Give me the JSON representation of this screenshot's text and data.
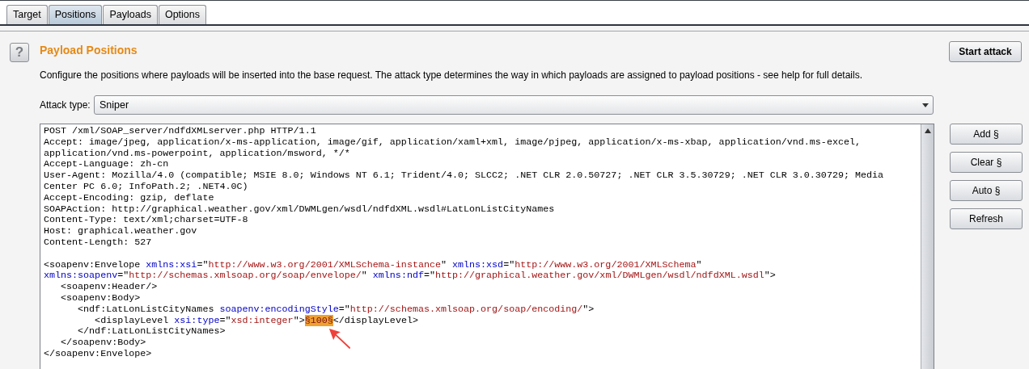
{
  "tabs": [
    {
      "label": "Target",
      "selected": false
    },
    {
      "label": "Positions",
      "selected": true
    },
    {
      "label": "Payloads",
      "selected": false
    },
    {
      "label": "Options",
      "selected": false
    }
  ],
  "help_icon": "?",
  "title": "Payload Positions",
  "description": "Configure the positions where payloads will be inserted into the base request. The attack type determines the way in which payloads are assigned to payload positions - see help for full details.",
  "start_button": "Start attack",
  "attack_type": {
    "label": "Attack type:",
    "value": "Sniper"
  },
  "editor_lines": [
    {
      "segments": [
        {
          "kind": "text",
          "text": "POST /xml/SOAP_server/ndfdXMLserver.php HTTP/1.1"
        }
      ]
    },
    {
      "segments": [
        {
          "kind": "text",
          "text": "Accept: image/jpeg, application/x-ms-application, image/gif, application/xaml+xml, image/pjpeg, application/x-ms-xbap, application/vnd.ms-excel,"
        }
      ]
    },
    {
      "segments": [
        {
          "kind": "text",
          "text": "application/vnd.ms-powerpoint, application/msword, */*"
        }
      ]
    },
    {
      "segments": [
        {
          "kind": "text",
          "text": "Accept-Language: zh-cn"
        }
      ]
    },
    {
      "segments": [
        {
          "kind": "text",
          "text": "User-Agent: Mozilla/4.0 (compatible; MSIE 8.0; Windows NT 6.1; Trident/4.0; SLCC2; .NET CLR 2.0.50727; .NET CLR 3.5.30729; .NET CLR 3.0.30729; Media"
        }
      ]
    },
    {
      "segments": [
        {
          "kind": "text",
          "text": "Center PC 6.0; InfoPath.2; .NET4.0C)"
        }
      ]
    },
    {
      "segments": [
        {
          "kind": "text",
          "text": "Accept-Encoding: gzip, deflate"
        }
      ]
    },
    {
      "segments": [
        {
          "kind": "text",
          "text": "SOAPAction: http://graphical.weather.gov/xml/DWMLgen/wsdl/ndfdXML.wsdl#LatLonListCityNames"
        }
      ]
    },
    {
      "segments": [
        {
          "kind": "text",
          "text": "Content-Type: text/xml;charset=UTF-8"
        }
      ]
    },
    {
      "segments": [
        {
          "kind": "text",
          "text": "Host: graphical.weather.gov"
        }
      ]
    },
    {
      "segments": [
        {
          "kind": "text",
          "text": "Content-Length: 527"
        }
      ]
    },
    {
      "kind": "blank"
    },
    {
      "segments": [
        {
          "kind": "text",
          "text": "<soapenv:Envelope "
        },
        {
          "kind": "attr",
          "text": "xmlns:xsi"
        },
        {
          "kind": "text",
          "text": "=\""
        },
        {
          "kind": "value",
          "text": "http://www.w3.org/2001/XMLSchema-instance"
        },
        {
          "kind": "text",
          "text": "\" "
        },
        {
          "kind": "attr",
          "text": "xmlns:xsd"
        },
        {
          "kind": "text",
          "text": "=\""
        },
        {
          "kind": "value",
          "text": "http://www.w3.org/2001/XMLSchema"
        },
        {
          "kind": "text",
          "text": "\""
        }
      ]
    },
    {
      "segments": [
        {
          "kind": "attr",
          "text": "xmlns:soapenv"
        },
        {
          "kind": "text",
          "text": "=\""
        },
        {
          "kind": "value",
          "text": "http://schemas.xmlsoap.org/soap/envelope/"
        },
        {
          "kind": "text",
          "text": "\" "
        },
        {
          "kind": "attr",
          "text": "xmlns:ndf"
        },
        {
          "kind": "text",
          "text": "=\""
        },
        {
          "kind": "value",
          "text": "http://graphical.weather.gov/xml/DWMLgen/wsdl/ndfdXML.wsdl"
        },
        {
          "kind": "text",
          "text": "\">"
        }
      ]
    },
    {
      "segments": [
        {
          "kind": "text",
          "text": "   <soapenv:Header/>"
        }
      ]
    },
    {
      "segments": [
        {
          "kind": "text",
          "text": "   <soapenv:Body>"
        }
      ]
    },
    {
      "segments": [
        {
          "kind": "text",
          "text": "      <ndf:LatLonListCityNames "
        },
        {
          "kind": "attr",
          "text": "soapenv:encodingStyle"
        },
        {
          "kind": "text",
          "text": "=\""
        },
        {
          "kind": "value",
          "text": "http://schemas.xmlsoap.org/soap/encoding/"
        },
        {
          "kind": "text",
          "text": "\">"
        }
      ]
    },
    {
      "segments": [
        {
          "kind": "text",
          "text": "         <displayLevel "
        },
        {
          "kind": "attr",
          "text": "xsi:type"
        },
        {
          "kind": "text",
          "text": "=\""
        },
        {
          "kind": "value",
          "text": "xsd:integer"
        },
        {
          "kind": "text",
          "text": "\">"
        },
        {
          "kind": "marker",
          "text": "§100§"
        },
        {
          "kind": "text",
          "text": "</displayLevel>"
        }
      ]
    },
    {
      "segments": [
        {
          "kind": "text",
          "text": "      </ndf:LatLonListCityNames>"
        }
      ]
    },
    {
      "segments": [
        {
          "kind": "text",
          "text": "   </soapenv:Body>"
        }
      ]
    },
    {
      "segments": [
        {
          "kind": "text",
          "text": "</soapenv:Envelope>"
        }
      ]
    }
  ],
  "side_buttons": [
    "Add §",
    "Clear §",
    "Auto §",
    "Refresh"
  ]
}
